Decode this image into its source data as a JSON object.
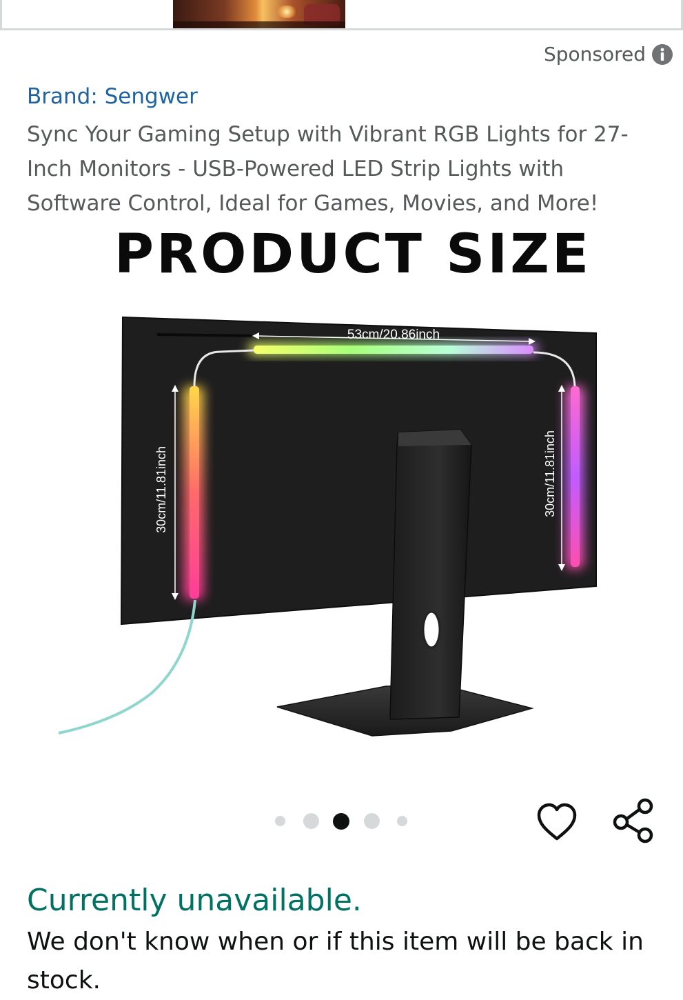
{
  "banner": {
    "image_name": "living-room-lights-thumbnail"
  },
  "sponsored": {
    "label": "Sponsored",
    "icon": "info-icon"
  },
  "product": {
    "brand": "Brand: Sengwer",
    "title": "Sync Your Gaming Setup with Vibrant RGB Lights for 27-Inch Monitors - USB-Powered LED Strip Lights with Software Control, Ideal for Games, Movies, and More!",
    "image": {
      "heading": "PRODUCT SIZE",
      "top_dimension": "53cm/20.86inch",
      "left_dimension": "30cm/11.81inch",
      "right_dimension": "30cm/11.81inch"
    }
  },
  "carousel": {
    "total": 5,
    "active_index": 2
  },
  "actions": {
    "wishlist_icon": "heart-icon",
    "share_icon": "share-icon"
  },
  "availability": {
    "status": "Currently unavailable.",
    "message": "We don't know when or if this item will be back in stock."
  },
  "colors": {
    "brand_link": "#2162a1",
    "title_text": "#565959",
    "unavailable": "#007162"
  }
}
